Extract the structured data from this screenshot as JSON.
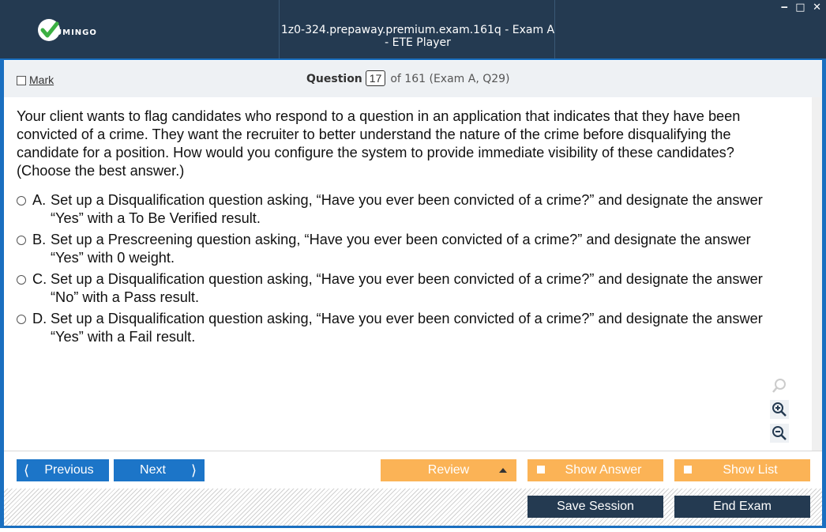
{
  "titlebar": {
    "logo_text": "UMINGO",
    "window_title": "1z0-324.prepaway.premium.exam.161q - Exam A - ETE Player",
    "controls": {
      "minimize": "‒",
      "maximize": "□",
      "close": "✕"
    }
  },
  "header": {
    "mark_label": "Mark",
    "question_label": "Question",
    "question_number": "17",
    "question_of": "of 161 (Exam A, Q29)"
  },
  "question": {
    "text": "Your client wants to flag candidates who respond to a question in an application that indicates that they have been convicted of a crime. They want the recruiter to better understand the nature of the crime before disqualifying the candidate for a position. How would you configure the system to provide immediate visibility of these candidates? (Choose the best answer.)"
  },
  "answers": [
    {
      "letter": "A.",
      "text": "Set up a Disqualification question asking, “Have you ever been convicted of a crime?” and designate the answer “Yes” with a To Be Verified result."
    },
    {
      "letter": "B.",
      "text": "Set up a Prescreening question asking, “Have you ever been convicted of a crime?” and designate the answer “Yes” with 0 weight."
    },
    {
      "letter": "C.",
      "text": "Set up a Disqualification question asking, “Have you ever been convicted of a crime?” and designate the answer “No” with a Pass result."
    },
    {
      "letter": "D.",
      "text": "Set up a Disqualification question asking, “Have you ever been convicted of a crime?” and designate the answer “Yes” with a Fail result."
    }
  ],
  "nav": {
    "previous_label": "Previous",
    "next_label": "Next",
    "review_label": "Review",
    "show_answer_label": "Show Answer",
    "show_list_label": "Show List",
    "save_session_label": "Save Session",
    "end_exam_label": "End Exam"
  },
  "icons": {
    "logo": "check-circle-icon",
    "zoom": [
      "search-icon",
      "zoom-in-icon",
      "zoom-out-icon"
    ]
  },
  "colors": {
    "titlebar_bg": "#243a51",
    "accent_blue": "#1c75c8",
    "orange": "#fbb356",
    "dark_button": "#243a51"
  }
}
